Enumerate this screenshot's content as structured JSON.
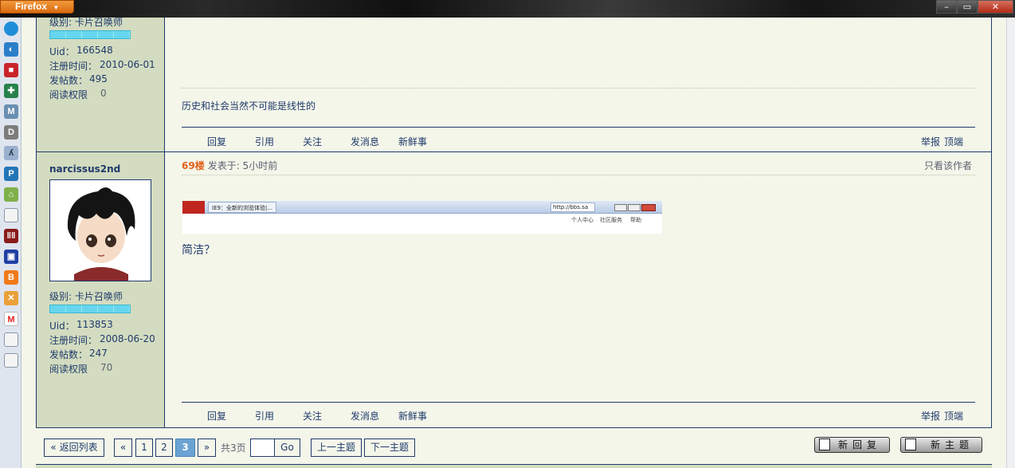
{
  "browser": {
    "app_button": "Firefox",
    "window_controls": [
      "minimize",
      "maximize",
      "close"
    ],
    "sidebar_icons": [
      "bubble-icon",
      "bubble-outline-icon",
      "cube-icon",
      "green-plugin-icon",
      "m-icon",
      "d-icon",
      "bike-icon",
      "p-icon",
      "house-icon",
      "page-icon",
      "books-icon",
      "blue-box-icon",
      "blogger-icon",
      "cart-icon",
      "gmail-icon",
      "page-icon",
      "page-icon"
    ]
  },
  "post1": {
    "level_label": "级别: 卡片召唤师",
    "uid_label": "Uid：",
    "uid": "166548",
    "reg_label": "注册时间：",
    "reg_date": "2010-06-01",
    "posts_label": "发帖数：",
    "posts": "495",
    "read_label": "阅读权限",
    "read_level": "0",
    "content": "历史和社会当然不可能是线性的"
  },
  "post2": {
    "username": "narcissus2nd",
    "level_label": "级别: 卡片召唤师",
    "uid_label": "Uid：",
    "uid": "113853",
    "reg_label": "注册时间：",
    "reg_date": "2008-06-20",
    "posts_label": "发帖数：",
    "posts": "247",
    "read_label": "阅读权限",
    "read_level": "70",
    "floor": "69楼",
    "posted": "发表于: 5小时前",
    "only_author": "只看该作者",
    "embedded": {
      "tab_title": "IE9：全新的浏览体验|...",
      "url": "http://bbs.sa",
      "links": [
        "个人中心",
        "社区服务",
        "帮助"
      ]
    },
    "content": "简洁？"
  },
  "actions": {
    "reply": "回复",
    "quote": "引用",
    "follow": "关注",
    "message": "发消息",
    "fresh": "新鲜事",
    "report": "举报",
    "top": "顶端"
  },
  "pagination": {
    "back": "« 返回列表",
    "prev": "«",
    "pages": [
      "1",
      "2",
      "3"
    ],
    "current": "3",
    "next": "»",
    "total": "共3页",
    "go": "Go",
    "prev_topic": "上一主题",
    "next_topic": "下一主题",
    "new_reply": "新回复",
    "new_topic": "新主题"
  },
  "colors": {
    "accent": "#1f3a6b",
    "side_bg": "#d3dcc0",
    "floor": "#e2611d",
    "current_page": "#6aa2d4"
  }
}
